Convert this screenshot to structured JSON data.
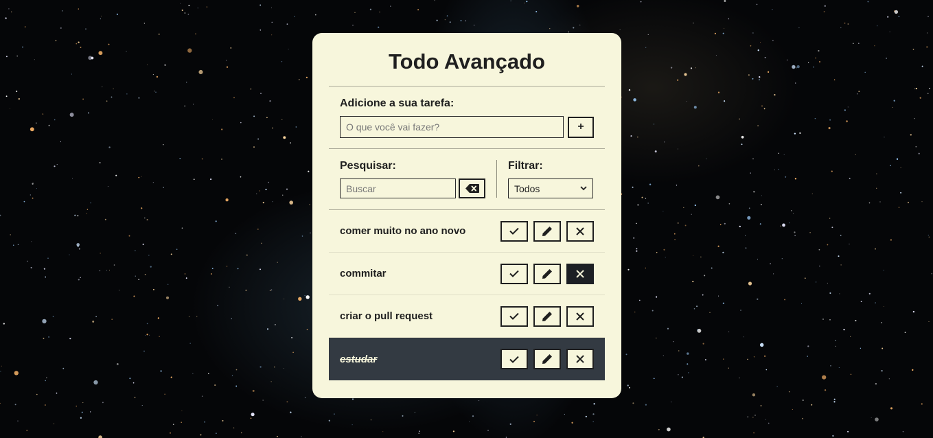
{
  "app": {
    "title": "Todo Avançado"
  },
  "add_form": {
    "label": "Adicione a sua tarefa:",
    "input_placeholder": "O que você vai fazer?",
    "input_value": "",
    "add_button_label": "+"
  },
  "search": {
    "label": "Pesquisar:",
    "placeholder": "Buscar",
    "value": "",
    "clear_icon": "backspace-icon"
  },
  "filter": {
    "label": "Filtrar:",
    "selected": "Todos"
  },
  "todos": [
    {
      "text": "comer muito no ano novo",
      "done": false
    },
    {
      "text": "commitar",
      "done": false
    },
    {
      "text": "criar o pull request",
      "done": false
    },
    {
      "text": "estudar",
      "done": true
    }
  ],
  "icons": {
    "finish": "check-icon",
    "edit": "pencil-icon",
    "remove": "x-icon"
  },
  "colors": {
    "card_background": "#f7f6dc",
    "done_row_background": "#333a42",
    "text": "#1f1f1f",
    "background": "#050608"
  }
}
